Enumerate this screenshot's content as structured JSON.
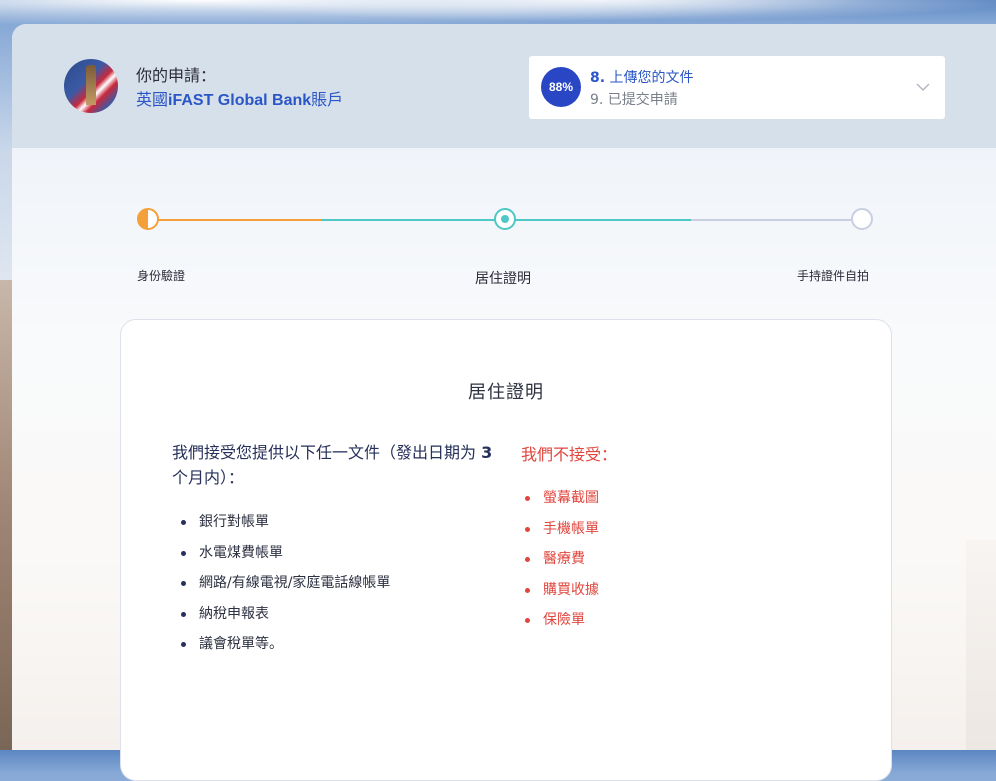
{
  "header": {
    "application_label": "你的申請：",
    "application_name_prefix": "英國",
    "application_name_brand": "iFAST Global Bank",
    "application_name_suffix": "賬戶"
  },
  "progress_card": {
    "percent": "88%",
    "current_step_number": "8.",
    "current_step_label": "上傳您的文件",
    "next_step": "9. 已提交申請"
  },
  "stepper": {
    "steps": [
      {
        "label": "身份驗證",
        "state": "partial"
      },
      {
        "label": "居住證明",
        "state": "current"
      },
      {
        "label": "手持證件自拍",
        "state": "pending"
      }
    ]
  },
  "document_card": {
    "title": "居住證明",
    "accept_heading_part1": "我們接受您提供以下任一文件（發出日期为 ",
    "accept_heading_bold": "3",
    "accept_heading_part2": " 个月内）：",
    "accepted": [
      "銀行對帳單",
      "水電煤費帳單",
      "網路/有線電視/家庭電話線帳單",
      "納稅申報表",
      "議會稅單等。"
    ],
    "reject_heading": "我們不接受：",
    "rejected": [
      "螢幕截圖",
      "手機帳單",
      "醫療費",
      "購買收據",
      "保險單"
    ]
  },
  "colors": {
    "accent_blue": "#2947c4",
    "link_blue": "#2a56c6",
    "orange": "#f4a03a",
    "teal": "#4fc7c4",
    "reject_red": "#e0463e"
  }
}
